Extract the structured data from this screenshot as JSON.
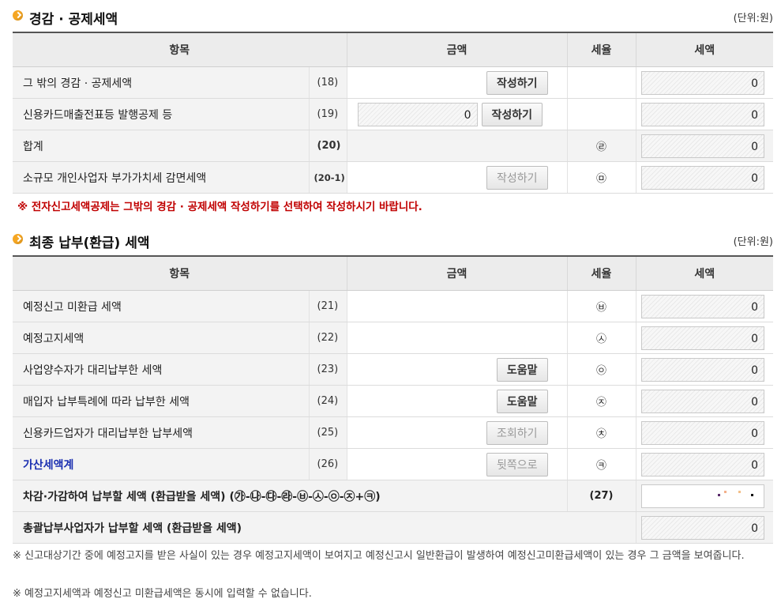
{
  "section1": {
    "title": "경감 · 공제세액",
    "unit": "(단위:원)",
    "headers": [
      "항목",
      "금액",
      "세율",
      "세액"
    ],
    "rows": [
      {
        "label": "그 밖의 경감 · 공제세액",
        "no": "(18)",
        "button": "작성하기",
        "rate": "",
        "tax": "0"
      },
      {
        "label": "신용카드매출전표등 발행공제 등",
        "no": "(19)",
        "amount": "0",
        "button": "작성하기",
        "rate": "",
        "tax": "0"
      },
      {
        "label": "합계",
        "no": "(20)",
        "rate": "㉣",
        "tax": "0"
      },
      {
        "label": "소규모 개인사업자 부가가치세 감면세액",
        "no": "(20-1)",
        "button": "작성하기",
        "rate": "㉤",
        "tax": "0"
      }
    ],
    "notice": "※ 전자신고세액공제는 그밖의 경감 · 공제세액 작성하기를 선택하여 작성하시기 바랍니다."
  },
  "section2": {
    "title": "최종 납부(환급) 세액",
    "unit": "(단위:원)",
    "headers": [
      "항목",
      "금액",
      "세율",
      "세액"
    ],
    "rows": [
      {
        "label": "예정신고 미환급 세액",
        "no": "(21)",
        "rate": "㉥",
        "tax": "0"
      },
      {
        "label": "예정고지세액",
        "no": "(22)",
        "rate": "㉦",
        "tax": "0"
      },
      {
        "label": "사업양수자가 대리납부한 세액",
        "no": "(23)",
        "button": "도움말",
        "rate": "㉧",
        "tax": "0"
      },
      {
        "label": "매입자 납부특례에 따라 납부한 세액",
        "no": "(24)",
        "button": "도움말",
        "rate": "㉨",
        "tax": "0"
      },
      {
        "label": "신용카드업자가 대리납부한 납부세액",
        "no": "(25)",
        "button": "조회하기",
        "rate": "㉩",
        "tax": "0"
      },
      {
        "label": "가산세액계",
        "no": "(26)",
        "button": "뒷쪽으로",
        "rate": "㉪",
        "tax": "0"
      },
      {
        "label": "차감·가감하여 납부할 세액 (환급받을 세액) (㉮-㉯-㉰-㉱-㉥-㉦-㉧-㉨+㉪)",
        "no": "(27)"
      },
      {
        "label": "총괄납부사업자가 납부할 세액 (환급받을 세액)",
        "tax": "0"
      }
    ]
  },
  "notes": [
    "※ 신고대상기간 중에 예정고지를 받은 사실이 있는 경우 예정고지세액이 보여지고 예정신고시 일반환급이 발생하여 예정신고미환급세액이 있는 경우 그 금액을 보여줍니다.",
    "※ 예정고지세액과 예정신고 미환급세액은 동시에 입력할 수 없습니다."
  ],
  "colors": {
    "accent_icon": "#f5a623",
    "notice_red": "#c00000",
    "link_blue": "#1a2fb0"
  }
}
